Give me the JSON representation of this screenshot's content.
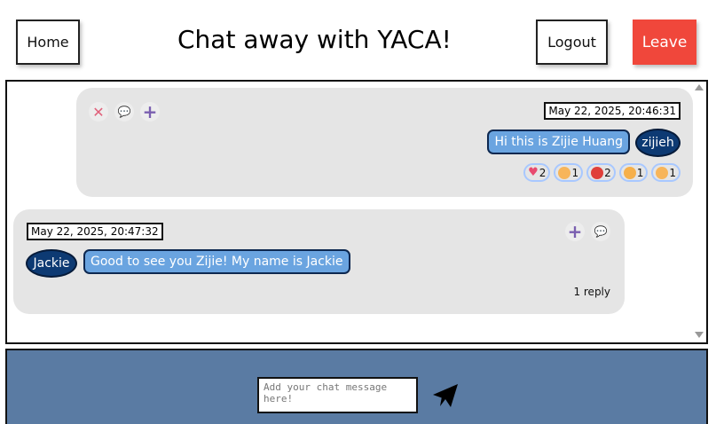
{
  "header": {
    "home_label": "Home",
    "title": "Chat away with YACA!",
    "logout_label": "Logout",
    "leave_label": "Leave"
  },
  "messages": [
    {
      "timestamp": "May 22, 2025, 20:46:31",
      "text": "Hi this is Zijie Huang",
      "user": "zijieh",
      "reactions": [
        {
          "emoji": "heart",
          "count": "2"
        },
        {
          "emoji": "smile-tongue",
          "count": "1"
        },
        {
          "emoji": "angry",
          "count": "2"
        },
        {
          "emoji": "laugh",
          "count": "1"
        },
        {
          "emoji": "grin",
          "count": "1"
        }
      ]
    },
    {
      "timestamp": "May 22, 2025, 20:47:32",
      "text": "Good to see you Zijie! My name is Jackie",
      "user": "Jackie",
      "reply_count": "1 reply"
    }
  ],
  "composer": {
    "placeholder": "Add your chat message here!"
  },
  "colors": {
    "leave_button": "#f0473b",
    "bubble": "#6aa4e0",
    "user_pill": "#0d3a73",
    "composer_bg": "#5a7ba3",
    "message_bg": "#e5e5e5"
  }
}
